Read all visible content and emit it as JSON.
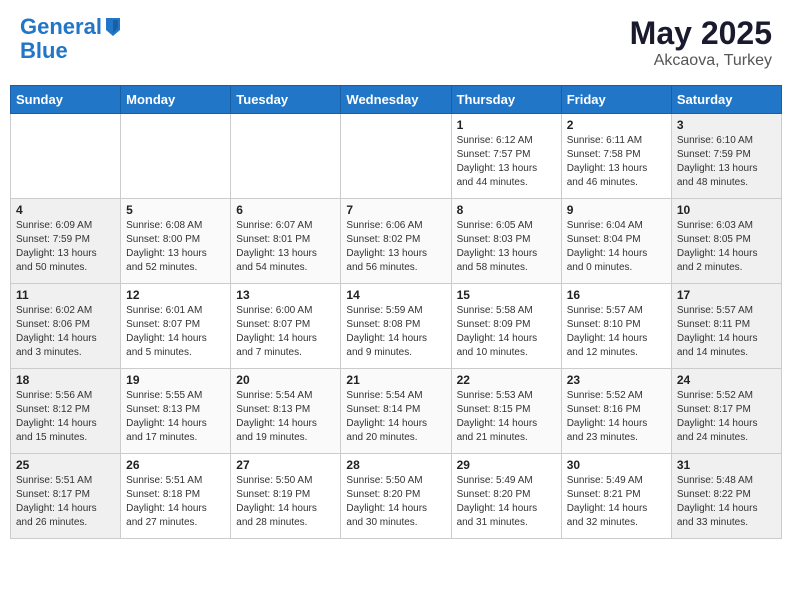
{
  "header": {
    "logo_line1": "General",
    "logo_line2": "Blue",
    "month_year": "May 2025",
    "location": "Akcaova, Turkey"
  },
  "weekdays": [
    "Sunday",
    "Monday",
    "Tuesday",
    "Wednesday",
    "Thursday",
    "Friday",
    "Saturday"
  ],
  "weeks": [
    [
      {
        "day": "",
        "info": ""
      },
      {
        "day": "",
        "info": ""
      },
      {
        "day": "",
        "info": ""
      },
      {
        "day": "",
        "info": ""
      },
      {
        "day": "1",
        "info": "Sunrise: 6:12 AM\nSunset: 7:57 PM\nDaylight: 13 hours\nand 44 minutes."
      },
      {
        "day": "2",
        "info": "Sunrise: 6:11 AM\nSunset: 7:58 PM\nDaylight: 13 hours\nand 46 minutes."
      },
      {
        "day": "3",
        "info": "Sunrise: 6:10 AM\nSunset: 7:59 PM\nDaylight: 13 hours\nand 48 minutes."
      }
    ],
    [
      {
        "day": "4",
        "info": "Sunrise: 6:09 AM\nSunset: 7:59 PM\nDaylight: 13 hours\nand 50 minutes."
      },
      {
        "day": "5",
        "info": "Sunrise: 6:08 AM\nSunset: 8:00 PM\nDaylight: 13 hours\nand 52 minutes."
      },
      {
        "day": "6",
        "info": "Sunrise: 6:07 AM\nSunset: 8:01 PM\nDaylight: 13 hours\nand 54 minutes."
      },
      {
        "day": "7",
        "info": "Sunrise: 6:06 AM\nSunset: 8:02 PM\nDaylight: 13 hours\nand 56 minutes."
      },
      {
        "day": "8",
        "info": "Sunrise: 6:05 AM\nSunset: 8:03 PM\nDaylight: 13 hours\nand 58 minutes."
      },
      {
        "day": "9",
        "info": "Sunrise: 6:04 AM\nSunset: 8:04 PM\nDaylight: 14 hours\nand 0 minutes."
      },
      {
        "day": "10",
        "info": "Sunrise: 6:03 AM\nSunset: 8:05 PM\nDaylight: 14 hours\nand 2 minutes."
      }
    ],
    [
      {
        "day": "11",
        "info": "Sunrise: 6:02 AM\nSunset: 8:06 PM\nDaylight: 14 hours\nand 3 minutes."
      },
      {
        "day": "12",
        "info": "Sunrise: 6:01 AM\nSunset: 8:07 PM\nDaylight: 14 hours\nand 5 minutes."
      },
      {
        "day": "13",
        "info": "Sunrise: 6:00 AM\nSunset: 8:07 PM\nDaylight: 14 hours\nand 7 minutes."
      },
      {
        "day": "14",
        "info": "Sunrise: 5:59 AM\nSunset: 8:08 PM\nDaylight: 14 hours\nand 9 minutes."
      },
      {
        "day": "15",
        "info": "Sunrise: 5:58 AM\nSunset: 8:09 PM\nDaylight: 14 hours\nand 10 minutes."
      },
      {
        "day": "16",
        "info": "Sunrise: 5:57 AM\nSunset: 8:10 PM\nDaylight: 14 hours\nand 12 minutes."
      },
      {
        "day": "17",
        "info": "Sunrise: 5:57 AM\nSunset: 8:11 PM\nDaylight: 14 hours\nand 14 minutes."
      }
    ],
    [
      {
        "day": "18",
        "info": "Sunrise: 5:56 AM\nSunset: 8:12 PM\nDaylight: 14 hours\nand 15 minutes."
      },
      {
        "day": "19",
        "info": "Sunrise: 5:55 AM\nSunset: 8:13 PM\nDaylight: 14 hours\nand 17 minutes."
      },
      {
        "day": "20",
        "info": "Sunrise: 5:54 AM\nSunset: 8:13 PM\nDaylight: 14 hours\nand 19 minutes."
      },
      {
        "day": "21",
        "info": "Sunrise: 5:54 AM\nSunset: 8:14 PM\nDaylight: 14 hours\nand 20 minutes."
      },
      {
        "day": "22",
        "info": "Sunrise: 5:53 AM\nSunset: 8:15 PM\nDaylight: 14 hours\nand 21 minutes."
      },
      {
        "day": "23",
        "info": "Sunrise: 5:52 AM\nSunset: 8:16 PM\nDaylight: 14 hours\nand 23 minutes."
      },
      {
        "day": "24",
        "info": "Sunrise: 5:52 AM\nSunset: 8:17 PM\nDaylight: 14 hours\nand 24 minutes."
      }
    ],
    [
      {
        "day": "25",
        "info": "Sunrise: 5:51 AM\nSunset: 8:17 PM\nDaylight: 14 hours\nand 26 minutes."
      },
      {
        "day": "26",
        "info": "Sunrise: 5:51 AM\nSunset: 8:18 PM\nDaylight: 14 hours\nand 27 minutes."
      },
      {
        "day": "27",
        "info": "Sunrise: 5:50 AM\nSunset: 8:19 PM\nDaylight: 14 hours\nand 28 minutes."
      },
      {
        "day": "28",
        "info": "Sunrise: 5:50 AM\nSunset: 8:20 PM\nDaylight: 14 hours\nand 30 minutes."
      },
      {
        "day": "29",
        "info": "Sunrise: 5:49 AM\nSunset: 8:20 PM\nDaylight: 14 hours\nand 31 minutes."
      },
      {
        "day": "30",
        "info": "Sunrise: 5:49 AM\nSunset: 8:21 PM\nDaylight: 14 hours\nand 32 minutes."
      },
      {
        "day": "31",
        "info": "Sunrise: 5:48 AM\nSunset: 8:22 PM\nDaylight: 14 hours\nand 33 minutes."
      }
    ]
  ]
}
